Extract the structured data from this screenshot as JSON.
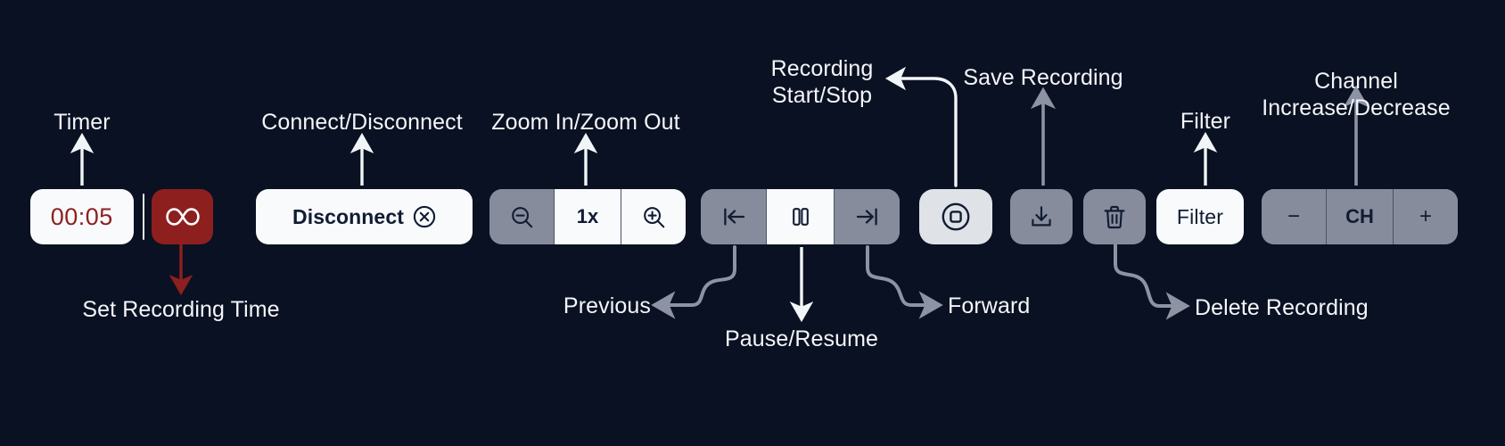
{
  "theme": {
    "background": "#0a1122",
    "button_white": "#f8fafc",
    "button_gray": "#868c9c",
    "button_red": "#8e1f1f",
    "record_button": "#dfe3e8",
    "icon_dark": "#111c33",
    "label_text": "#f4f6f9",
    "arrow_white": "#f2f5f8",
    "arrow_gray": "#8d93a3",
    "arrow_red": "#8e1f1f",
    "timer_text": "#8e1f1f"
  },
  "toolbar": {
    "timer": {
      "value": "00:05",
      "infinity_label": "∞",
      "infinity_icon": "infinity-icon"
    },
    "connection": {
      "label": "Disconnect",
      "icon": "close-circle-icon"
    },
    "zoom": {
      "zoom_out_icon": "magnifier-minus-icon",
      "level": "1x",
      "zoom_in_icon": "magnifier-plus-icon"
    },
    "transport": {
      "previous_icon": "skip-previous-icon",
      "pause_icon": "pause-icon",
      "forward_icon": "skip-next-icon"
    },
    "record": {
      "icon": "record-stop-icon"
    },
    "save": {
      "icon": "download-icon"
    },
    "delete": {
      "icon": "trash-icon"
    },
    "filter": {
      "label": "Filter"
    },
    "channel": {
      "decrease_label": "−",
      "label": "CH",
      "increase_label": "+"
    }
  },
  "annotations": [
    {
      "id": "timer",
      "text": "Timer"
    },
    {
      "id": "set_time",
      "text": "Set Recording Time"
    },
    {
      "id": "connect",
      "text": "Connect/Disconnect"
    },
    {
      "id": "zoom",
      "text": "Zoom In/Zoom Out"
    },
    {
      "id": "previous",
      "text": "Previous"
    },
    {
      "id": "pause",
      "text": "Pause/Resume"
    },
    {
      "id": "forward",
      "text": "Forward"
    },
    {
      "id": "recording",
      "text": "Recording\nStart/Stop"
    },
    {
      "id": "save",
      "text": "Save Recording"
    },
    {
      "id": "delete",
      "text": "Delete Recording"
    },
    {
      "id": "filter",
      "text": "Filter"
    },
    {
      "id": "channel",
      "text": "Channel\nIncrease/Decrease"
    }
  ]
}
